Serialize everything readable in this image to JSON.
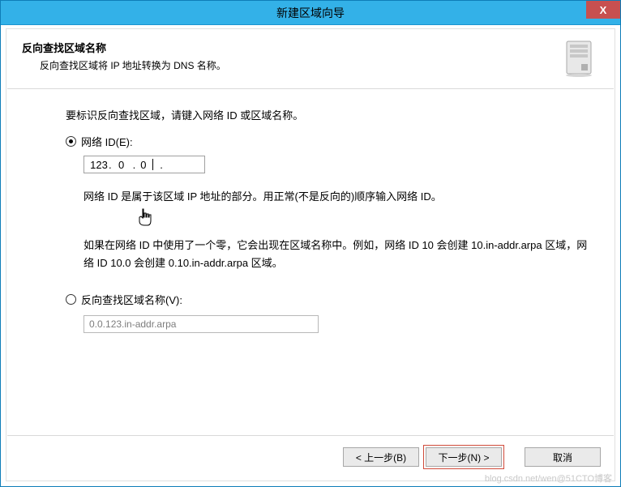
{
  "window": {
    "title": "新建区域向导",
    "close_label": "X"
  },
  "header": {
    "title": "反向查找区域名称",
    "subtitle": "反向查找区域将 IP 地址转换为 DNS 名称。"
  },
  "form": {
    "intro": "要标识反向查找区域，请键入网络 ID 或区域名称。",
    "network_id_label": "网络 ID(E):",
    "ip": {
      "o1": "123",
      "o2": "0",
      "o3": "0",
      "o4": ""
    },
    "help1": "网络 ID 是属于该区域 IP 地址的部分。用正常(不是反向的)顺序输入网络 ID。",
    "help2": "如果在网络 ID 中使用了一个零，它会出现在区域名称中。例如，网络 ID 10 会创建 10.in-addr.arpa 区域，网络 ID 10.0 会创建 0.10.in-addr.arpa 区域。",
    "zone_name_label": "反向查找区域名称(V):",
    "zone_name_value": "0.0.123.in-addr.arpa"
  },
  "footer": {
    "back": "< 上一步(B)",
    "next": "下一步(N) >",
    "cancel": "取消"
  },
  "watermark": "blog.csdn.net/wen@51CTO博客"
}
